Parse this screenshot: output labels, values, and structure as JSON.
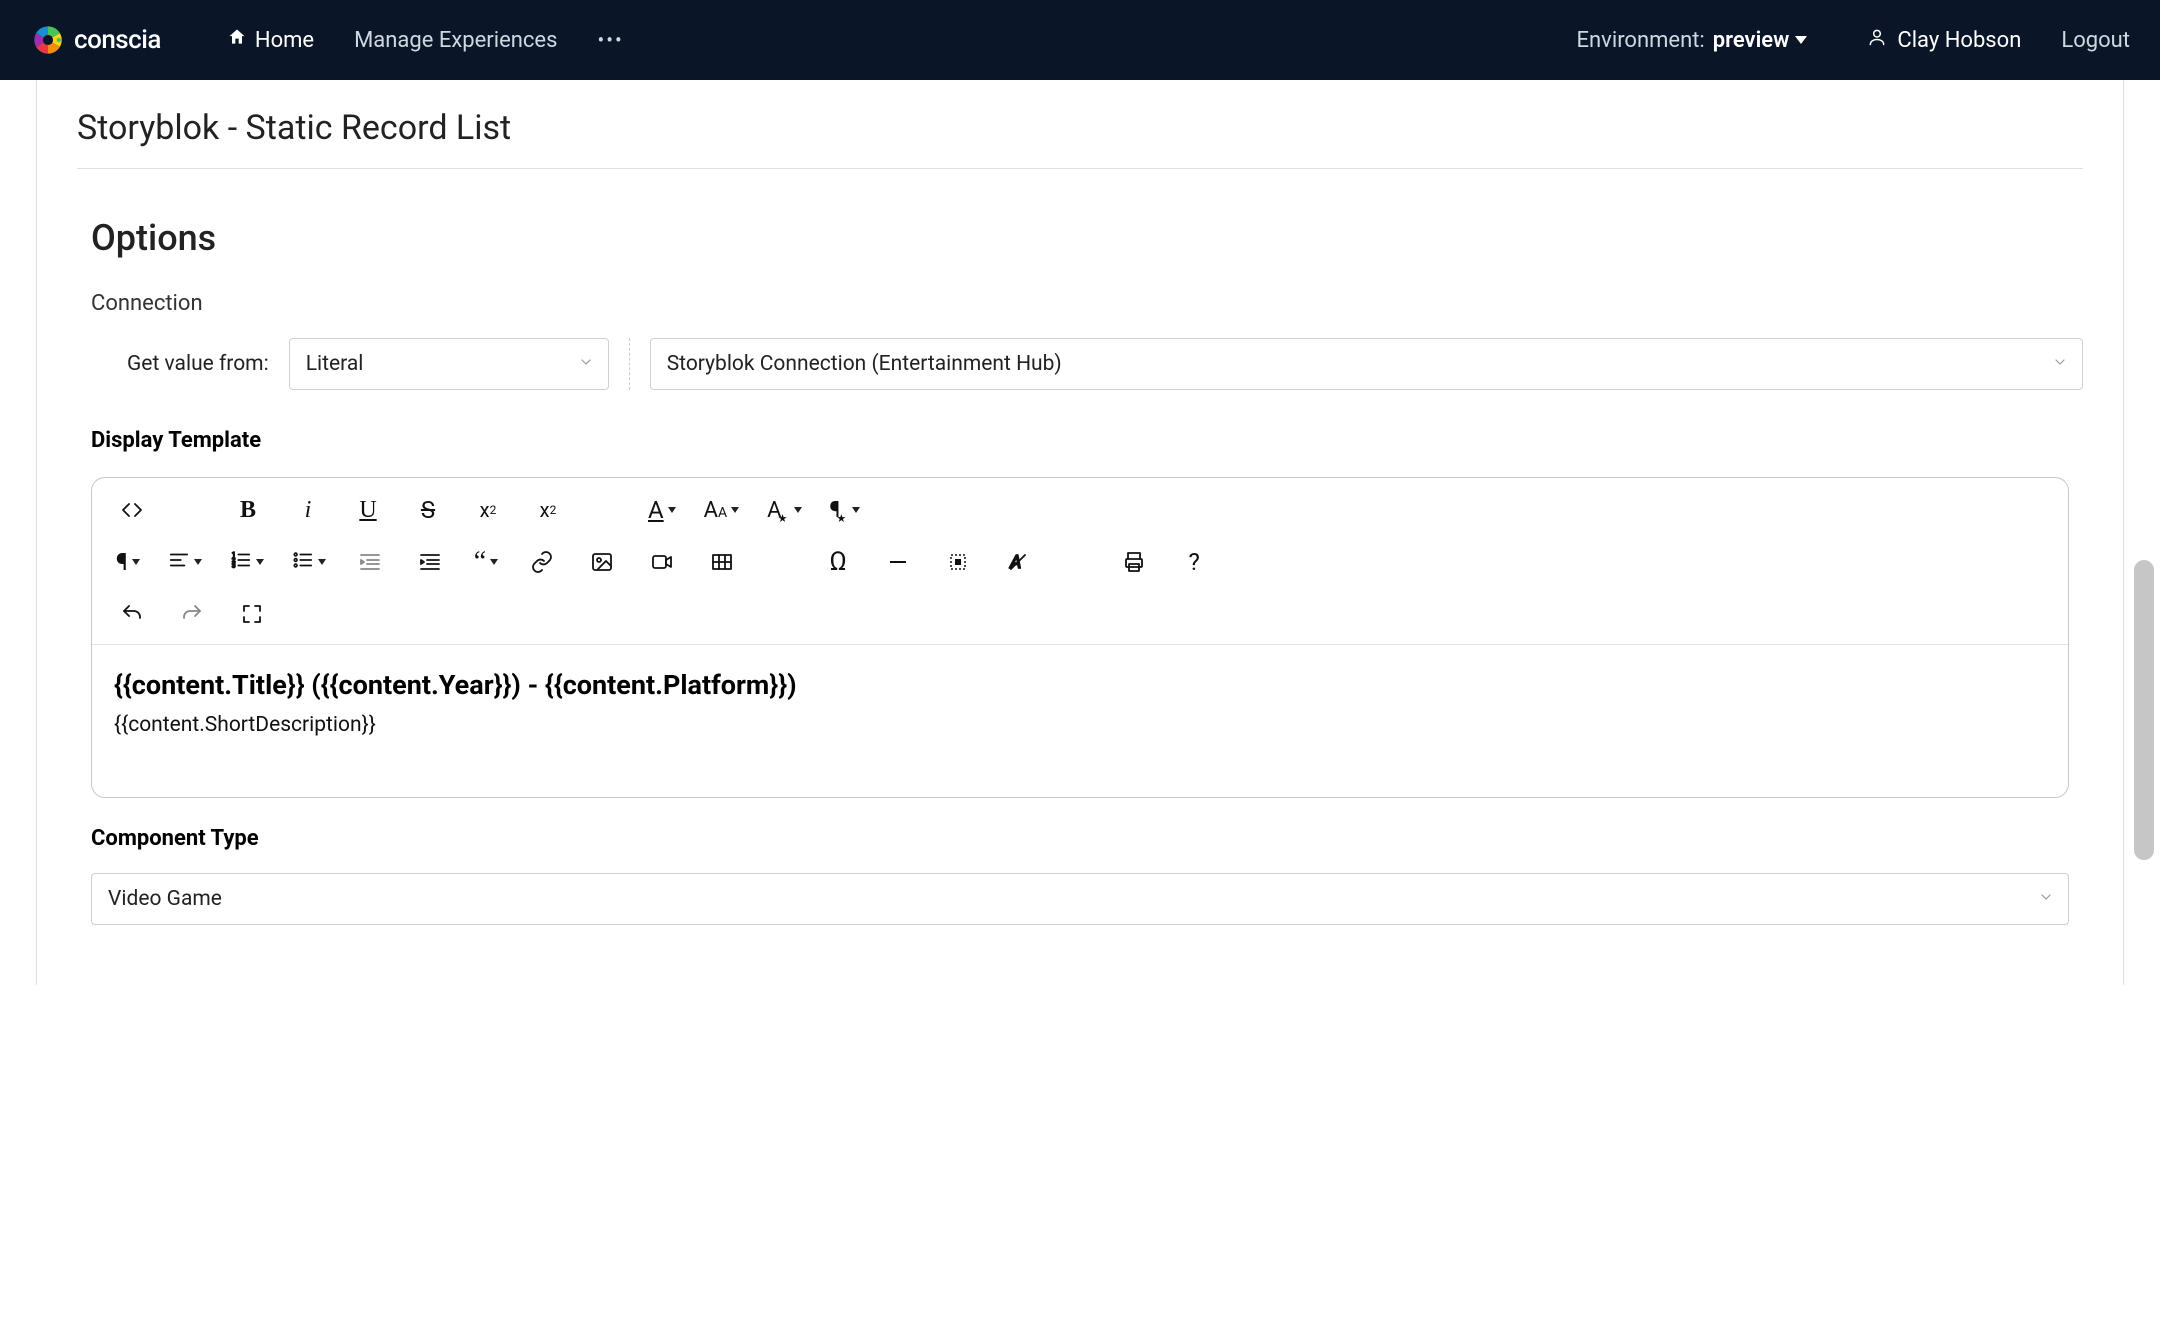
{
  "header": {
    "logo_text": "conscia",
    "nav_home": "Home",
    "nav_manage": "Manage Experiences",
    "env_label": "Environment:",
    "env_value": "preview",
    "user_name": "Clay Hobson",
    "logout": "Logout"
  },
  "card": {
    "title": "Storyblok - Static Record List"
  },
  "options": {
    "section_title": "Options",
    "connection_label": "Connection",
    "get_from_label": "Get value from:",
    "get_from_value": "Literal",
    "connection_value": "Storyblok Connection (Entertainment Hub)",
    "display_template_label": "Display Template",
    "template_line1": "{{content.Title}} ({{content.Year}}) - {{content.Platform}})",
    "template_line2": "{{content.ShortDescription}}",
    "component_type_label": "Component Type",
    "component_type_value": "Video Game"
  }
}
